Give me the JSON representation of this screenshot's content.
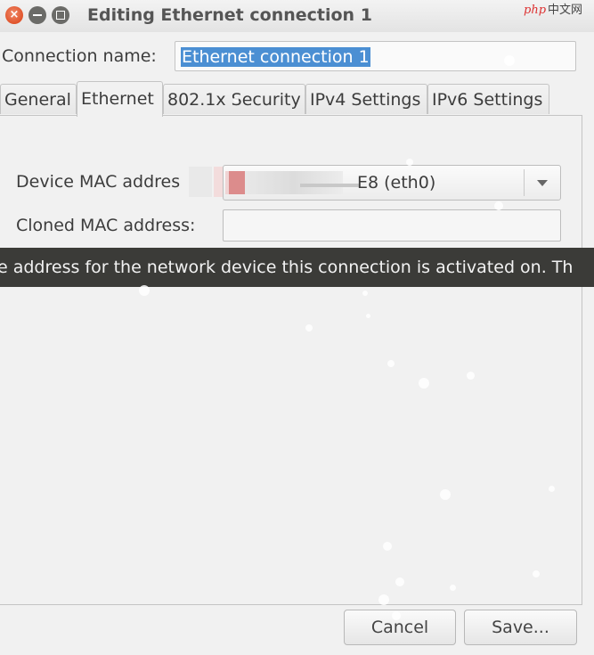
{
  "window": {
    "title": "Editing Ethernet connection 1",
    "controls": [
      "close",
      "minimize",
      "maximize"
    ]
  },
  "watermark": {
    "brand": "php",
    "text": "中文网"
  },
  "connection": {
    "label": "Connection name:",
    "value": "Ethernet connection 1"
  },
  "tabs": [
    {
      "label": "General",
      "active": false
    },
    {
      "label": "Ethernet",
      "active": true
    },
    {
      "label": "802.1x Security",
      "active": false
    },
    {
      "label": "IPv4 Settings",
      "active": false
    },
    {
      "label": "IPv6 Settings",
      "active": false
    }
  ],
  "ethernet": {
    "device_mac_label": "Device MAC addres",
    "device_mac_value": "E8 (eth0)",
    "cloned_mac_label": "Cloned MAC address:"
  },
  "tooltip": {
    "text": "e address for the network device this connection is activated on.  Th"
  },
  "buttons": {
    "cancel": "Cancel",
    "save": "Save..."
  },
  "colors": {
    "selection": "#4b8fd3",
    "close_button": "#e0532a",
    "tooltip_bg": "#3b3b38"
  }
}
